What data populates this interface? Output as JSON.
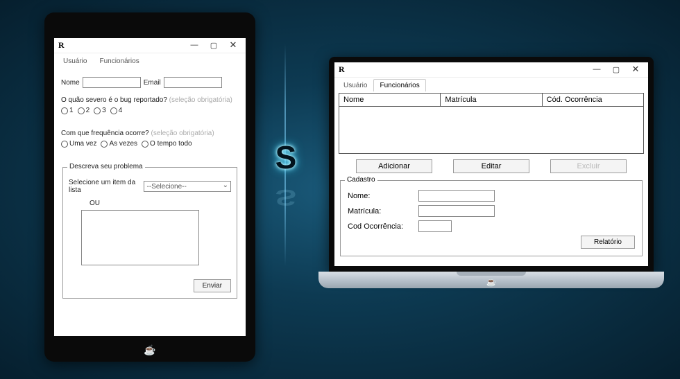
{
  "tablet": {
    "app_icon_char": "R",
    "tabs": {
      "usuario": "Usuário",
      "funcionarios": "Funcionários"
    },
    "form": {
      "nome_label": "Nome",
      "email_label": "Email",
      "severity": {
        "question": "O quão severo é o bug reportado?",
        "hint": "(seleção obrigatória)",
        "options": [
          "1",
          "2",
          "3",
          "4"
        ]
      },
      "frequency": {
        "question": "Com que frequência ocorre?",
        "hint": "(seleção obrigatória)",
        "options": [
          "Uma vez",
          "As vezes",
          "O tempo todo"
        ]
      },
      "problem": {
        "legend": "Descreva seu problema",
        "select_label": "Selecione um item da lista",
        "select_value": "--Selecione--",
        "or_label": "OU"
      },
      "submit_label": "Enviar"
    }
  },
  "laptop": {
    "app_icon_char": "R",
    "tabs": {
      "usuario": "Usuário",
      "funcionarios": "Funcionários"
    },
    "table": {
      "columns": [
        "Nome",
        "Matrícula",
        "Cód. Ocorrência"
      ]
    },
    "buttons": {
      "add": "Adicionar",
      "edit": "Editar",
      "delete": "Excluir"
    },
    "cadastro": {
      "legend": "Cadastro",
      "nome_label": "Nome:",
      "matricula_label": "Matrícula:",
      "cod_label": "Cod Ocorrência:"
    },
    "report_label": "Relatório"
  },
  "center_logo_char": "S"
}
